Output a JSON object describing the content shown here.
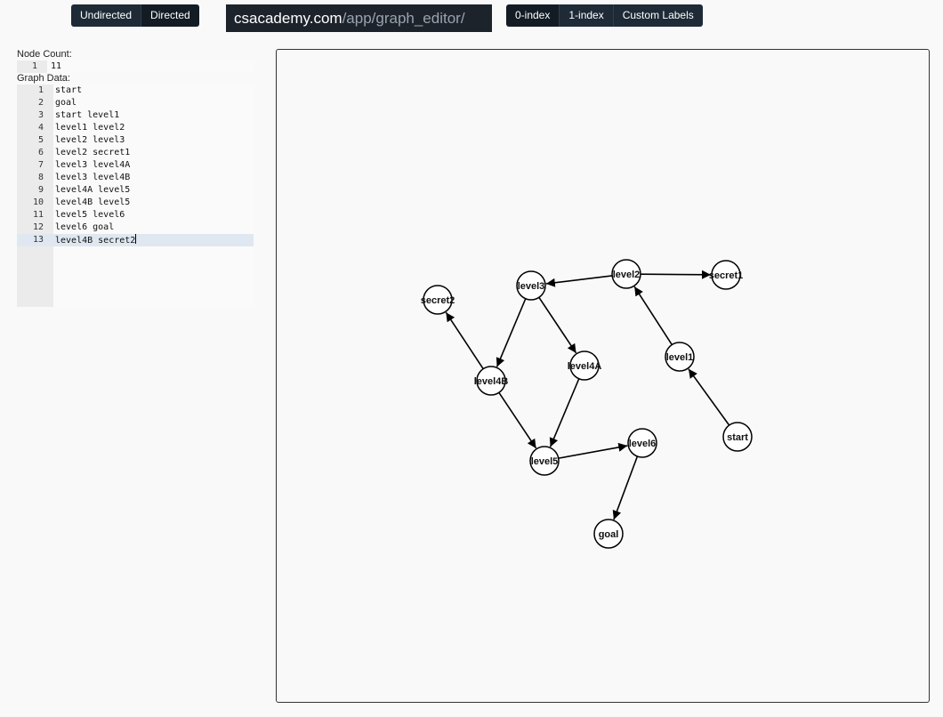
{
  "toolbar": {
    "direction_buttons": [
      {
        "label": "Undirected",
        "active": false
      },
      {
        "label": "Directed",
        "active": true
      }
    ],
    "url_host": "csacademy.com",
    "url_path": "/app/graph_editor/",
    "index_buttons": [
      {
        "label": "0-index",
        "active": true
      },
      {
        "label": "1-index",
        "active": false
      },
      {
        "label": "Custom Labels",
        "active": false
      }
    ]
  },
  "node_count": {
    "label": "Node Count:",
    "lines": [
      {
        "num": "1",
        "text": "11"
      }
    ]
  },
  "graph_data": {
    "label": "Graph Data:",
    "active_line": 13,
    "lines": [
      {
        "num": "1",
        "text": "start"
      },
      {
        "num": "2",
        "text": "goal"
      },
      {
        "num": "3",
        "text": "start level1"
      },
      {
        "num": "4",
        "text": "level1 level2"
      },
      {
        "num": "5",
        "text": "level2 level3"
      },
      {
        "num": "6",
        "text": "level2 secret1"
      },
      {
        "num": "7",
        "text": "level3 level4A"
      },
      {
        "num": "8",
        "text": "level3 level4B"
      },
      {
        "num": "9",
        "text": "level4A level5"
      },
      {
        "num": "10",
        "text": "level4B level5"
      },
      {
        "num": "11",
        "text": "level5 level6"
      },
      {
        "num": "12",
        "text": "level6 goal"
      },
      {
        "num": "13",
        "text": "level4B secret2"
      }
    ]
  },
  "graph": {
    "nodes": [
      "start",
      "goal",
      "level1",
      "level2",
      "level3",
      "level4A",
      "level4B",
      "level5",
      "level6",
      "secret1",
      "secret2"
    ],
    "edges": [
      [
        "start",
        "level1"
      ],
      [
        "level1",
        "level2"
      ],
      [
        "level2",
        "level3"
      ],
      [
        "level2",
        "secret1"
      ],
      [
        "level3",
        "level4A"
      ],
      [
        "level3",
        "level4B"
      ],
      [
        "level4A",
        "level5"
      ],
      [
        "level4B",
        "level5"
      ],
      [
        "level5",
        "level6"
      ],
      [
        "level6",
        "goal"
      ],
      [
        "level4B",
        "secret2"
      ]
    ],
    "node_color": "#ffffff",
    "edge_color": "#000000"
  }
}
